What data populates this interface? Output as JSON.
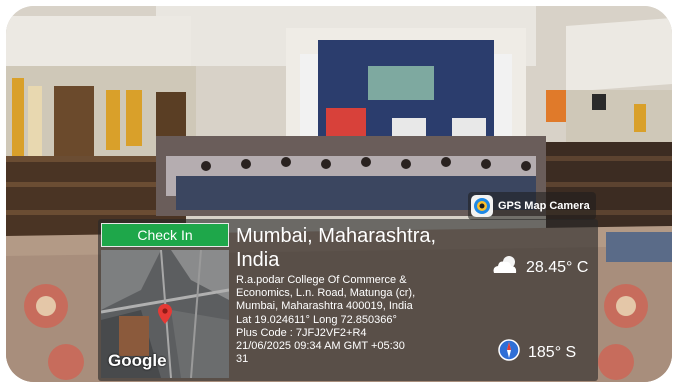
{
  "app": {
    "name": "GPS Map Camera",
    "icon": "gps-map-camera-icon"
  },
  "panel": {
    "checkin_label": "Check In",
    "map_brand": "Google",
    "city": "Mumbai, Maharashtra, India",
    "address_lines": [
      "R.a.podar College Of Commerce &",
      "Economics, L.n. Road, Matunga (cr),",
      "Mumbai, Maharashtra 400019, India"
    ],
    "coordinates": "Lat 19.024611° Long 72.850366°",
    "plus_code": "Plus Code : 7JFJ2VF2+R4",
    "datetime_line1": "21/06/2025 09:34 AM GMT +05:30",
    "datetime_line2": "31",
    "temperature": "28.45° C",
    "heading": "185° S"
  },
  "icons": {
    "weather": "partly-cloudy-icon",
    "compass": "compass-icon",
    "map_pin": "map-pin-icon"
  },
  "colors": {
    "checkin_bg": "#1ea74a",
    "pin": "#e53935",
    "panel_bg": "#282828"
  }
}
